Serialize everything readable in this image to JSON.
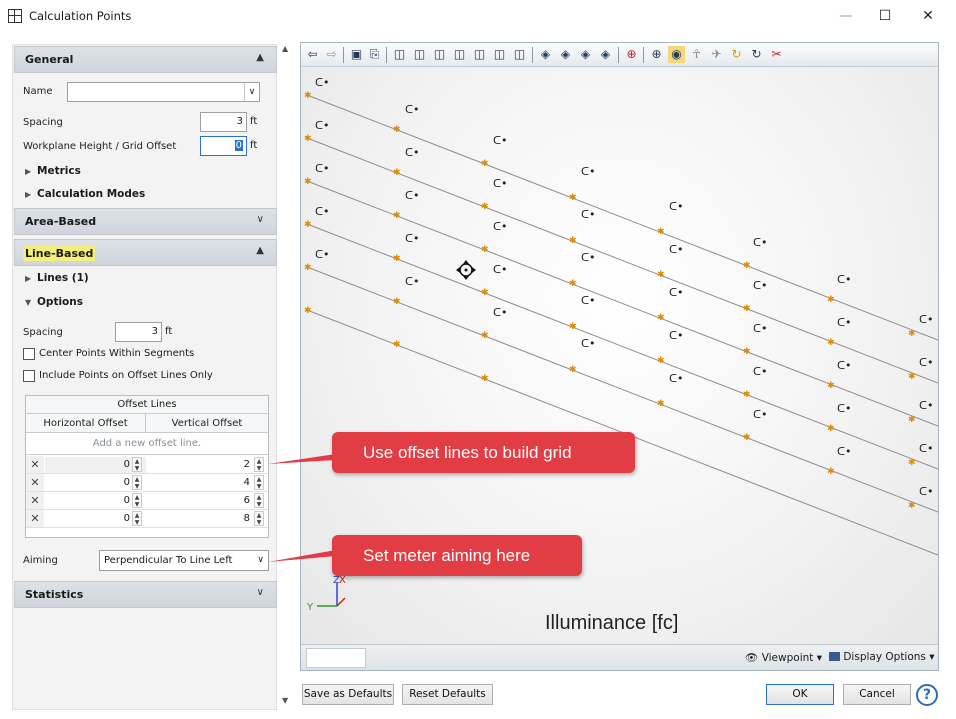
{
  "window": {
    "title": "Calculation Points",
    "minimize": "—",
    "maximize": "☐",
    "close": "✕"
  },
  "sections": {
    "general": "General",
    "area_based": "Area-Based",
    "line_based": "Line-Based",
    "statistics": "Statistics"
  },
  "general": {
    "name_label": "Name",
    "name_value": "",
    "spacing_label": "Spacing",
    "spacing_value": "3",
    "spacing_unit": "ft",
    "workplane_label": "Workplane Height / Grid Offset",
    "workplane_value": "0",
    "workplane_unit": "ft",
    "metrics": "Metrics",
    "calc_modes": "Calculation Modes"
  },
  "line_based": {
    "lines": "Lines (1)",
    "options": "Options",
    "spacing_label": "Spacing",
    "spacing_value": "3",
    "spacing_unit": "ft",
    "center_points": "Center Points Within Segments",
    "offset_only": "Include Points on Offset Lines Only",
    "offset_table": {
      "caption": "Offset Lines",
      "col_h": "Horizontal Offset",
      "col_v": "Vertical Offset",
      "add_row": "Add a new offset line.",
      "rows": [
        {
          "h": "0",
          "v": "2"
        },
        {
          "h": "0",
          "v": "4"
        },
        {
          "h": "0",
          "v": "6"
        },
        {
          "h": "0",
          "v": "8"
        }
      ]
    },
    "aiming_label": "Aiming",
    "aiming_value": "Perpendicular To Line Left"
  },
  "viewer": {
    "legend": "Illuminance [fc]",
    "axis_x": "X",
    "axis_y": "Y",
    "axis_z": "Z",
    "viewpoint": "Viewpoint",
    "display_options": "Display Options"
  },
  "footer": {
    "save_defaults": "Save as Defaults",
    "reset_defaults": "Reset Defaults",
    "ok": "OK",
    "cancel": "Cancel",
    "help": "?"
  },
  "callouts": {
    "offset": "Use offset lines to build grid",
    "aiming": "Set meter aiming here"
  },
  "colors": {
    "callout": "#e23c45",
    "highlight": "#f3f07a",
    "accent": "#2a72c8"
  }
}
